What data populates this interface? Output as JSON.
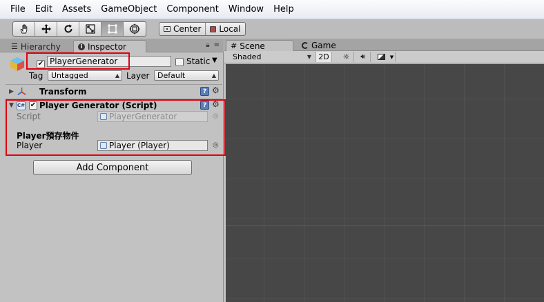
{
  "menubar": {
    "items": [
      "File",
      "Edit",
      "Assets",
      "GameObject",
      "Component",
      "Window",
      "Help"
    ]
  },
  "toolbar": {
    "tools": [
      "hand-tool",
      "move-tool",
      "rotate-tool",
      "scale-tool",
      "rect-tool",
      "transform-tool"
    ],
    "pivot": {
      "center_label": "Center",
      "local_label": "Local"
    }
  },
  "left_tabs": {
    "hierarchy_label": "Hierarchy",
    "inspector_label": "Inspector"
  },
  "inspector": {
    "object_name": "PlayerGenerator",
    "static_label": "Static",
    "tag_label": "Tag",
    "tag_value": "Untagged",
    "layer_label": "Layer",
    "layer_value": "Default",
    "transform_title": "Transform",
    "script_component": {
      "title": "Player Generator (Script)",
      "script_label": "Script",
      "script_value": "PlayerGenerator",
      "header_label": "Player預存物件",
      "player_label": "Player",
      "player_value": "Player (Player)"
    },
    "add_component_label": "Add Component"
  },
  "right_tabs": {
    "scene_label": "Scene",
    "game_label": "Game"
  },
  "scene_toolbar": {
    "shading_mode": "Shaded",
    "mode_2d": "2D"
  },
  "colors": {
    "highlight_red": "#e1000f",
    "viewport_bg": "#474747",
    "panel_bg": "#c2c2c2"
  }
}
